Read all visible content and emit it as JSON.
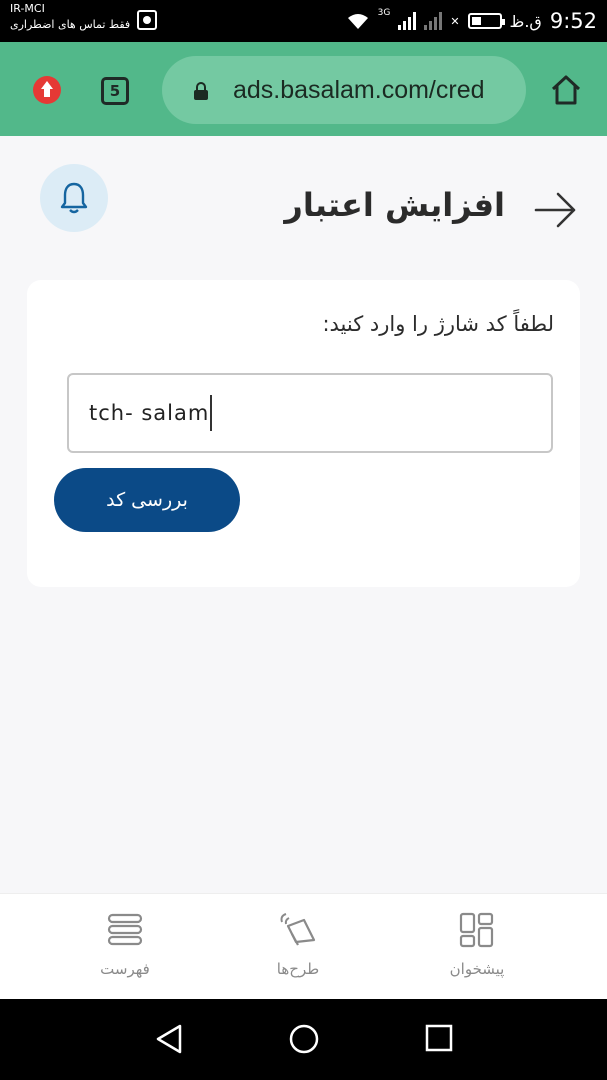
{
  "status_bar": {
    "carrier": "IR-MCI",
    "emergency_text": "فقط تماس های اضطراری",
    "network_type": "3G",
    "time": "9:52",
    "ampm": "ق.ظ"
  },
  "browser": {
    "url": "ads.basalam.com/cred",
    "tab_count": "5"
  },
  "header": {
    "title": "افزایش اعتبار"
  },
  "form": {
    "label": "لطفاً کد شارژ را وارد کنید:",
    "input_value": "tch- salam",
    "submit_label": "بررسی کد"
  },
  "bottom_nav": {
    "items": [
      {
        "label": "پیشخوان",
        "icon": "dashboard-icon"
      },
      {
        "label": "طرح‌ها",
        "icon": "megaphone-icon"
      },
      {
        "label": "فهرست",
        "icon": "menu-icon"
      }
    ]
  },
  "colors": {
    "browser_bar": "#52b88a",
    "primary_button": "#0b4a87",
    "bell_bg": "#dcecf6"
  }
}
